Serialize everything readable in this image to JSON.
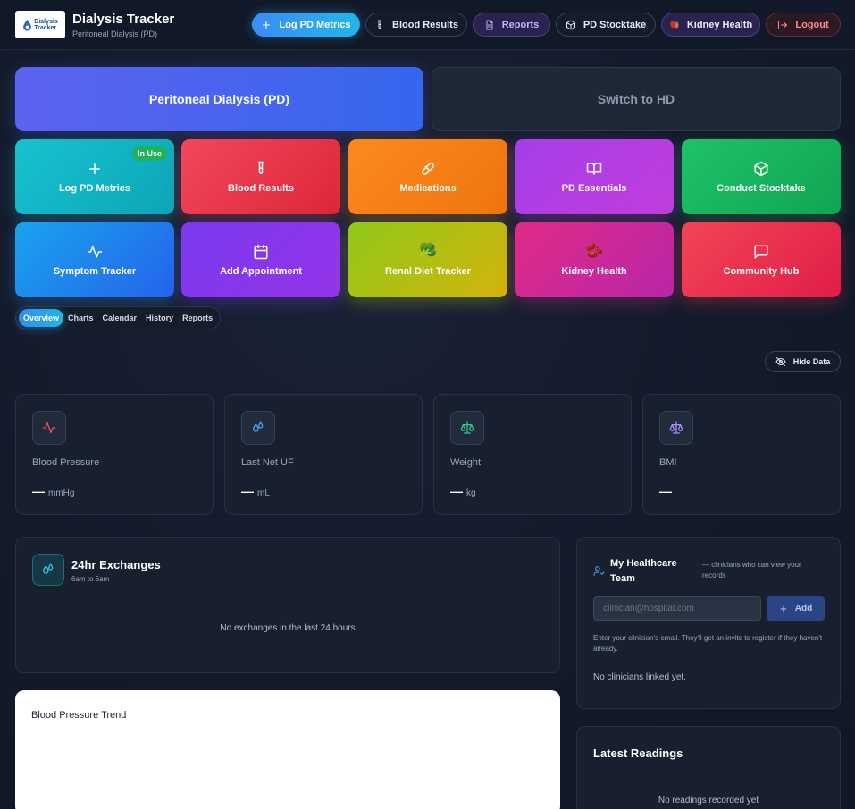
{
  "app": {
    "logo_text_1": "Dialysis",
    "logo_text_2": "Tracker",
    "title": "Dialysis Tracker",
    "subtitle": "Peritoneal Dialysis (PD)"
  },
  "header_nav": [
    {
      "label": "Log PD Metrics",
      "icon": "plus-icon"
    },
    {
      "label": "Blood Results",
      "icon": "test-tube-icon"
    },
    {
      "label": "Reports",
      "icon": "file-text-icon"
    },
    {
      "label": "PD Stocktake",
      "icon": "package-icon"
    },
    {
      "label": "Kidney Health",
      "icon": "kidney-icon"
    },
    {
      "label": "Logout",
      "icon": "logout-icon"
    }
  ],
  "mode": {
    "active_label": "Peritoneal Dialysis (PD)",
    "switch_label": "Switch to HD"
  },
  "tiles": [
    {
      "label": "Log PD Metrics",
      "icon": "plus-icon",
      "badge": "In Use",
      "color": "#14b8c8"
    },
    {
      "label": "Blood Results",
      "icon": "test-tube-icon",
      "color": "#ef3b4f"
    },
    {
      "label": "Medications",
      "icon": "pill-icon",
      "color": "#f97f16"
    },
    {
      "label": "PD Essentials",
      "icon": "book-open-icon",
      "color": "#b23ee8"
    },
    {
      "label": "Conduct Stocktake",
      "icon": "package-icon",
      "color": "#18b35e"
    },
    {
      "label": "Symptom Tracker",
      "icon": "activity-icon",
      "color": "#1f8ef0"
    },
    {
      "label": "Add Appointment",
      "icon": "calendar-icon",
      "color": "#7c3aed"
    },
    {
      "label": "Renal Diet Tracker",
      "icon": "broccoli-icon",
      "emoji": "🥦",
      "color": "#a3c012"
    },
    {
      "label": "Kidney Health",
      "icon": "kidney-icon",
      "emoji": "🫘",
      "color": "#d42b8e"
    },
    {
      "label": "Community Hub",
      "icon": "message-square-icon",
      "color": "#ee3148"
    }
  ],
  "subtabs": [
    {
      "label": "Overview",
      "active": true
    },
    {
      "label": "Charts"
    },
    {
      "label": "Calendar"
    },
    {
      "label": "History"
    },
    {
      "label": "Reports"
    }
  ],
  "hide_data_label": "Hide Data",
  "stats": [
    {
      "label": "Blood Pressure",
      "value": "—",
      "unit": "mmHg",
      "icon": "activity-icon",
      "color": "#ef4e5e"
    },
    {
      "label": "Last Net UF",
      "value": "—",
      "unit": "mL",
      "icon": "droplets-icon",
      "color": "#4ea3f0"
    },
    {
      "label": "Weight",
      "value": "—",
      "unit": "kg",
      "icon": "scale-icon",
      "color": "#2fc78a"
    },
    {
      "label": "BMI",
      "value": "—",
      "unit": "",
      "icon": "scale-icon",
      "color": "#a78bfa"
    }
  ],
  "exchanges": {
    "title": "24hr Exchanges",
    "subtitle": "6am to 6am",
    "empty": "No exchanges in the last 24 hours"
  },
  "bp_trend": {
    "title": "Blood Pressure Trend"
  },
  "team": {
    "title": "My Healthcare Team",
    "subtitle": "— clinicians who can view your records",
    "input_placeholder": "clinician@hospital.com",
    "add_label": "Add",
    "help": "Enter your clinician's email. They'll get an invite to register if they haven't already.",
    "empty": "No clinicians linked yet."
  },
  "latest": {
    "title": "Latest Readings",
    "empty": "No readings recorded yet"
  }
}
